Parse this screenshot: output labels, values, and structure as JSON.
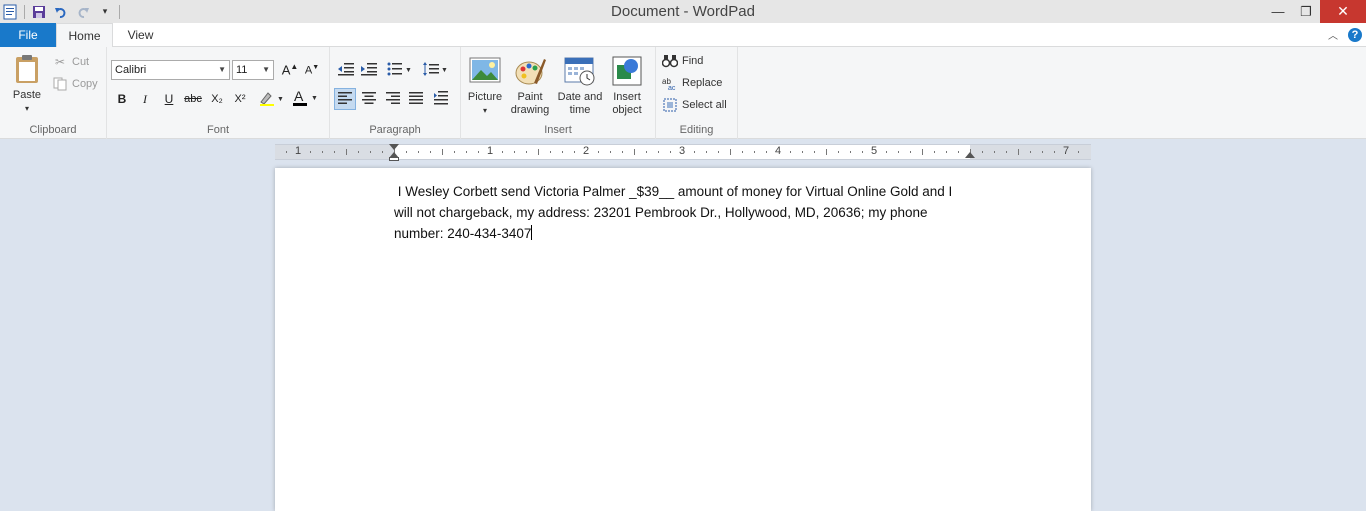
{
  "window": {
    "title": "Document - WordPad",
    "minimize_icon": "minimize-icon",
    "maximize_icon": "restore-icon",
    "close_icon": "close-icon"
  },
  "quick_access": [
    "wordpad-app-icon",
    "save-icon",
    "undo-icon",
    "redo-icon",
    "customize-dropdown-icon"
  ],
  "tabs": [
    {
      "label": "File"
    },
    {
      "label": "Home"
    },
    {
      "label": "View"
    }
  ],
  "ribbon": {
    "clipboard": {
      "label": "Clipboard",
      "paste": "Paste",
      "cut": "Cut",
      "copy": "Copy"
    },
    "font": {
      "label": "Font",
      "family": "Calibri",
      "size": "11",
      "bold": "B",
      "italic": "I",
      "underline": "U",
      "strike": "abc",
      "subscript": "X₂",
      "superscript": "X²"
    },
    "paragraph": {
      "label": "Paragraph"
    },
    "insert": {
      "label": "Insert",
      "picture": "Picture",
      "paint_line1": "Paint",
      "paint_line2": "drawing",
      "date_line1": "Date and",
      "date_line2": "time",
      "object_line1": "Insert",
      "object_line2": "object"
    },
    "editing": {
      "label": "Editing",
      "find": "Find",
      "replace": "Replace",
      "select_all": "Select all"
    }
  },
  "ruler": {
    "labels": [
      "1",
      "1",
      "2",
      "3",
      "4",
      "5",
      "7"
    ]
  },
  "document": {
    "line1": " I Wesley Corbett send Victoria Palmer _$39__ amount of money for Virtual Online Gold and I",
    "line2": "will not chargeback, my address: 23201 Pembrook Dr., Hollywood, MD, 20636; my phone",
    "line3": "number: 240-434-3407"
  },
  "colors": {
    "accent": "#1979ca",
    "close_button": "#c7372f",
    "ribbon_bg": "#f5f6f7",
    "workspace_bg": "#dbe3ee"
  }
}
